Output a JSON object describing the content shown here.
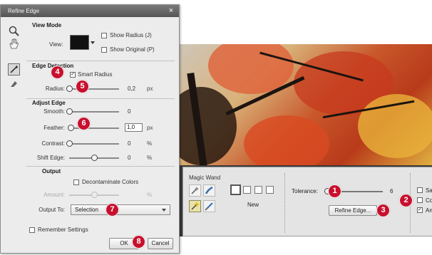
{
  "dialog": {
    "title": "Refine Edge",
    "close_label": "×",
    "view_mode": {
      "title": "View Mode",
      "view_label": "View:",
      "show_radius": {
        "label": "Show Radius (J)",
        "checked": false
      },
      "show_original": {
        "label": "Show Original (P)",
        "checked": false
      }
    },
    "edge_detection": {
      "title": "Edge Detection",
      "smart_radius": {
        "label": "Smart Radius",
        "checked": true
      },
      "radius": {
        "label": "Radius:",
        "value": "0,2",
        "unit": "px",
        "level": 0.0
      }
    },
    "adjust_edge": {
      "title": "Adjust Edge",
      "smooth": {
        "label": "Smooth:",
        "value": "0",
        "unit": "",
        "level": 0.0
      },
      "feather": {
        "label": "Feather:",
        "value": "1,0",
        "unit": "px",
        "level": 0.03
      },
      "contrast": {
        "label": "Contrast:",
        "value": "0",
        "unit": "%",
        "level": 0.0
      },
      "shift_edge": {
        "label": "Shift Edge:",
        "value": "0",
        "unit": "%",
        "level": 0.5
      }
    },
    "output": {
      "title": "Output",
      "decontaminate": {
        "label": "Decontaminate Colors",
        "checked": false
      },
      "amount": {
        "label": "Amount:",
        "unit": "%",
        "level": 0.5
      },
      "output_to_label": "Output To:",
      "output_to_value": "Selection"
    },
    "remember_settings": {
      "label": "Remember Settings",
      "checked": false
    },
    "ok_label": "OK",
    "cancel_label": "Cancel"
  },
  "tool_options": {
    "tool_name": "Magic Wand",
    "mode_label": "New",
    "tolerance": {
      "label": "Tolerance:",
      "value": "6",
      "level": 0.02
    },
    "refine_edge_label": "Refine Edge...",
    "right_checks": [
      {
        "label": "Sar",
        "checked": false
      },
      {
        "label": "Cor",
        "checked": false
      },
      {
        "label": "Ant",
        "checked": true
      }
    ]
  },
  "callouts": [
    "1",
    "2",
    "3",
    "4",
    "5",
    "6",
    "7",
    "8"
  ],
  "colors": {
    "callout": "#c8102e",
    "dialog_bg": "#ececec",
    "title_bar": "#666666"
  }
}
